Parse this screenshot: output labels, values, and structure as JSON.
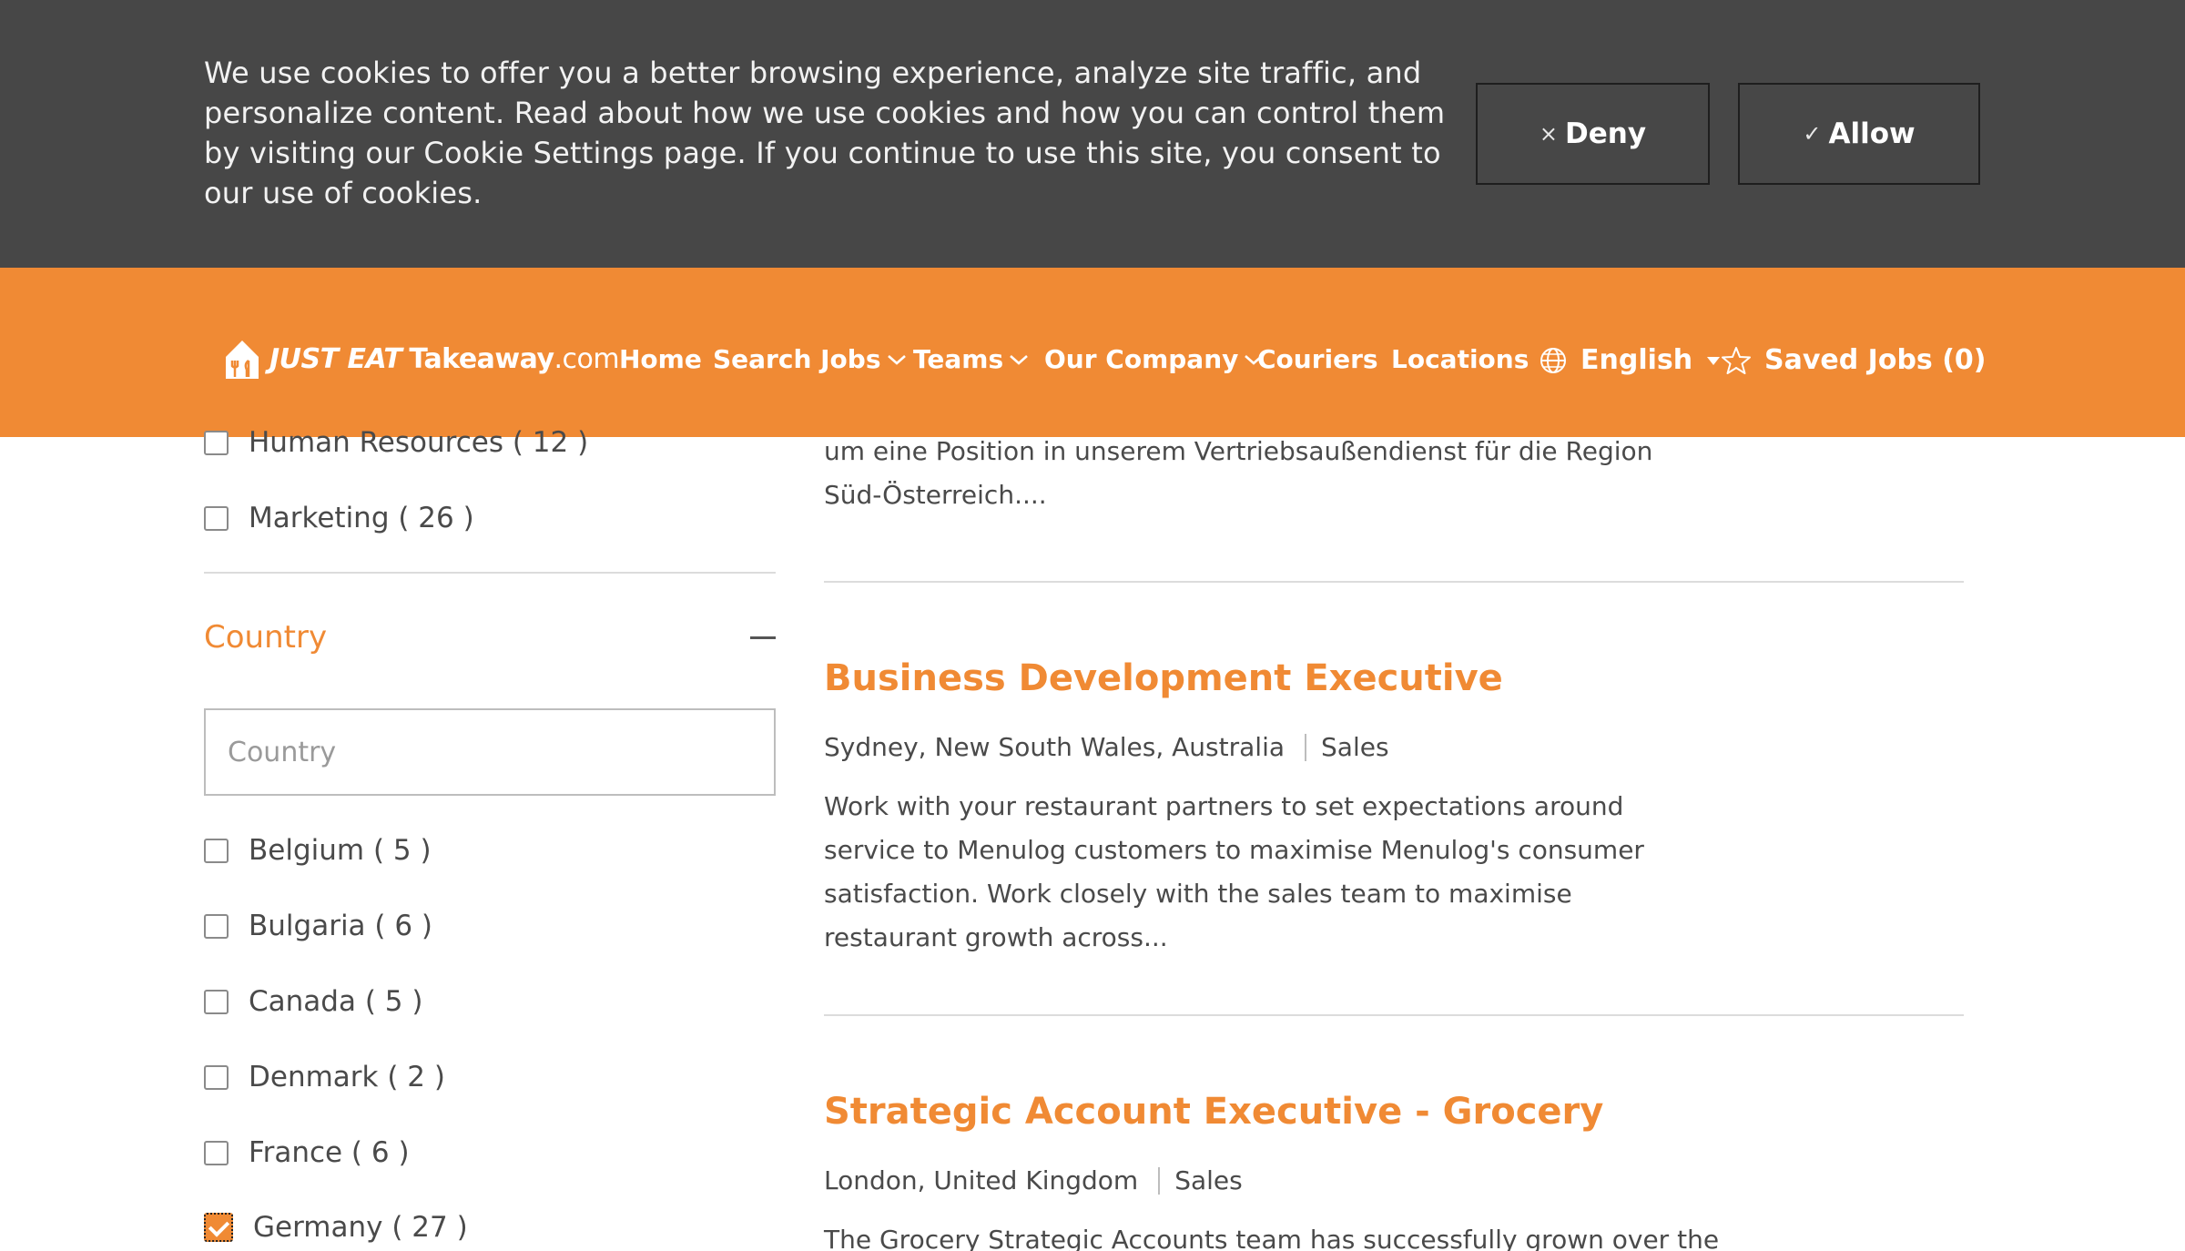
{
  "cookie_banner": {
    "text": "We use cookies to offer you a better browsing experience, analyze site traffic, and personalize content. Read about how we use cookies and how you can control them by visiting our Cookie Settings page. If you continue to use this site, you consent to our use of cookies.",
    "deny_label": "Deny",
    "allow_label": "Allow",
    "deny_icon": "×",
    "allow_icon": "✓"
  },
  "header": {
    "logo": {
      "part1": "JUST EAT",
      "part2": "Takeaway",
      "part3": ".com"
    },
    "nav": [
      {
        "label": "Home"
      },
      {
        "label": "Search Jobs"
      },
      {
        "label": "Teams"
      },
      {
        "label": "Our Company"
      },
      {
        "label": "Couriers"
      },
      {
        "label": "Locations"
      }
    ],
    "language": "English",
    "saved_jobs": "Saved Jobs (0)"
  },
  "filters": {
    "category_items": [
      {
        "label": "Human Resources ( 12 )",
        "checked": false
      },
      {
        "label": "Marketing ( 26 )",
        "checked": false
      }
    ],
    "country": {
      "title": "Country",
      "placeholder": "Country",
      "items": [
        {
          "label": "Belgium ( 5 )",
          "checked": false
        },
        {
          "label": "Bulgaria ( 6 )",
          "checked": false
        },
        {
          "label": "Canada ( 5 )",
          "checked": false
        },
        {
          "label": "Denmark ( 2 )",
          "checked": false
        },
        {
          "label": "France ( 6 )",
          "checked": false
        },
        {
          "label": "Germany ( 27 )",
          "checked": true
        }
      ]
    }
  },
  "jobs": {
    "previous_snippet": "um eine Position in unserem Vertriebsaußendienst für die Region Süd-Österreich....",
    "items": [
      {
        "title": "Business Development Executive",
        "location": "Sydney, New South Wales, Australia",
        "team": "Sales",
        "description": "Work with your restaurant partners to set expectations around service to Menulog customers to maximise Menulog's consumer satisfaction. Work closely with the sales team to maximise restaurant growth across..."
      },
      {
        "title": "Strategic Account Executive - Grocery",
        "location": "London, United Kingdom",
        "team": "Sales",
        "description": "The Grocery Strategic Accounts team has successfully grown over the"
      }
    ]
  },
  "colors": {
    "brand_orange": "#f08a34",
    "banner_grey": "#474747"
  }
}
